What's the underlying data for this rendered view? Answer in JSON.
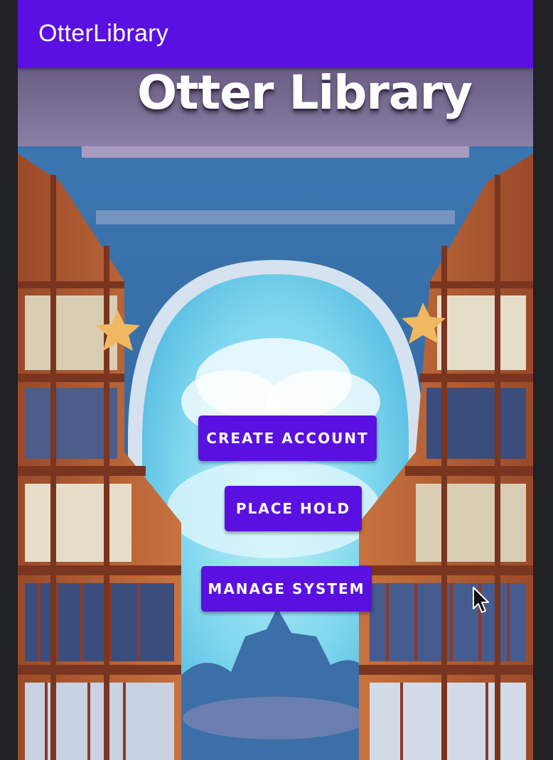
{
  "app_bar": {
    "title": "OtterLibrary",
    "background": "#5a10e0"
  },
  "hero": {
    "title": "Otter Library"
  },
  "buttons": {
    "create_account": "CREATE ACCOUNT",
    "place_hold": "PLACE HOLD",
    "manage_system": "MANAGE SYSTEM"
  },
  "background_image": {
    "icon": "library-illustration"
  },
  "colors": {
    "accent": "#5a10e0",
    "button_text": "#ffffff"
  }
}
